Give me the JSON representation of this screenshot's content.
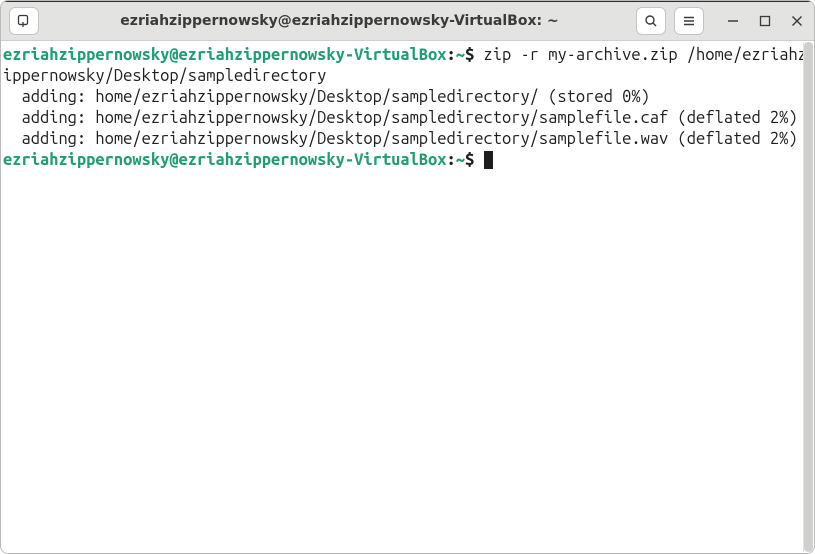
{
  "titlebar": {
    "title": "ezriahzippernowsky@ezriahzippernowsky-VirtualBox: ~"
  },
  "prompt": {
    "user_host": "ezriahzippernowsky@ezriahzippernowsky-VirtualBox",
    "separator": ":",
    "path": "~",
    "symbol": "$"
  },
  "lines": {
    "cmd1": " zip -r my-archive.zip /home/ezriahzippernowsky/Desktop/sampledirectory",
    "out1": "  adding: home/ezriahzippernowsky/Desktop/sampledirectory/ (stored 0%)",
    "out2": "  adding: home/ezriahzippernowsky/Desktop/sampledirectory/samplefile.caf (deflated 2%)",
    "out3": "  adding: home/ezriahzippernowsky/Desktop/sampledirectory/samplefile.wav (deflated 2%)"
  }
}
